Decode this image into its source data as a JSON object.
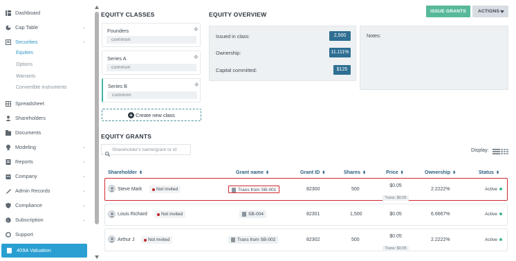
{
  "sidebar": {
    "items": [
      {
        "label": "Dashboard",
        "icon": "dashboard-icon"
      },
      {
        "label": "Cap Table",
        "icon": "cap-table-icon",
        "has_chevron": true
      },
      {
        "label": "Securities",
        "icon": "securities-icon",
        "has_chevron": true,
        "active": true
      },
      {
        "label": "Spreadsheet",
        "icon": "spreadsheet-icon"
      },
      {
        "label": "Shareholders",
        "icon": "shareholders-icon"
      },
      {
        "label": "Documents",
        "icon": "documents-icon"
      },
      {
        "label": "Modeling",
        "icon": "modeling-icon",
        "has_chevron": true
      },
      {
        "label": "Reports",
        "icon": "reports-icon",
        "has_chevron": true
      },
      {
        "label": "Company",
        "icon": "company-icon",
        "has_chevron": true
      },
      {
        "label": "Admin Records",
        "icon": "admin-records-icon",
        "has_chevron": true
      },
      {
        "label": "Compliance",
        "icon": "compliance-icon",
        "has_chevron": true
      },
      {
        "label": "Subscription",
        "icon": "subscription-icon",
        "has_chevron": true
      },
      {
        "label": "Support",
        "icon": "support-icon"
      }
    ],
    "sub_items": [
      {
        "label": "Equities",
        "active": true
      },
      {
        "label": "Options"
      },
      {
        "label": "Warrants"
      },
      {
        "label": "Convertible instruments"
      }
    ],
    "valuation_button": "409A Valuation",
    "chevron": "⌄"
  },
  "equity_classes": {
    "title": "EQUITY CLASSES",
    "classes": [
      {
        "name": "Founders",
        "type": "common"
      },
      {
        "name": "Series A",
        "type": "common"
      },
      {
        "name": "Series B",
        "type": "common"
      }
    ],
    "create_label": "Create new class"
  },
  "overview": {
    "title": "EQUITY OVERVIEW",
    "issued_label": "Issued in class:",
    "issued_value": "2,500",
    "ownership_label": "Ownership:",
    "ownership_value": "11.111%",
    "capital_label": "Capital committed:",
    "capital_value": "$125",
    "notes_label": "Notes:"
  },
  "toolbar": {
    "issue_grants": "ISSUE GRANTS",
    "actions": "ACTIONS"
  },
  "grants": {
    "title": "EQUITY GRANTS",
    "search_placeholder": "Shareholder's name/grant or id",
    "display_label": "Display:",
    "columns": {
      "shareholder": "Shareholder",
      "grant_name": "Grant name",
      "grant_id": "Grant ID",
      "shares": "Shares",
      "price": "Price",
      "ownership": "Ownership",
      "status": "Status"
    },
    "sort_glyph": "⬍",
    "rows": [
      {
        "name": "Steve Mark",
        "invite": "Not invited",
        "grant_name": "Trans from SB-001",
        "grant_id": "82300",
        "shares": "500",
        "price": "$0.05",
        "trans": "Trans: $0.05",
        "ownership": "2.2222%",
        "status": "Active"
      },
      {
        "name": "Louis Richard",
        "invite": "Not invited",
        "grant_name": "SB-004",
        "grant_id": "82301",
        "shares": "1,500",
        "price": "$0.05",
        "trans": "",
        "ownership": "6.6667%",
        "status": "Active"
      },
      {
        "name": "Arthur J",
        "invite": "Not invited",
        "grant_name": "Trans from SB-002",
        "grant_id": "82302",
        "shares": "500",
        "price": "$0.05",
        "trans": "Trans: $0.05",
        "ownership": "2.2222%",
        "status": "Active"
      }
    ]
  },
  "colors": {
    "accent": "#2a9fd1",
    "issue_button": "#58b99a",
    "overview_value": "#2f6f93",
    "highlight": "#d0272f",
    "not_invited_dot": "#c0272d",
    "active_dot": "#3fb68a"
  }
}
